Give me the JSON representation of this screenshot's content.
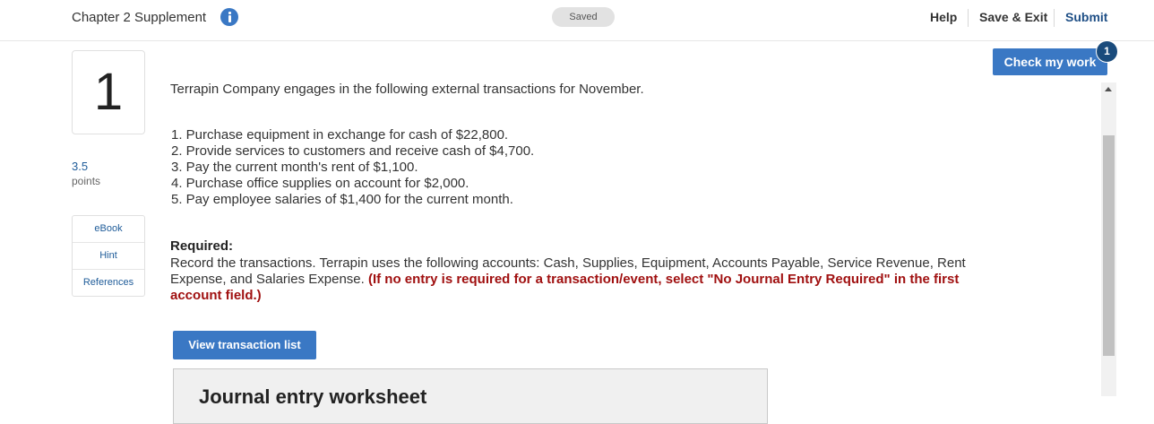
{
  "header": {
    "title": "Chapter 2 Supplement",
    "status": "Saved",
    "help": "Help",
    "save_exit": "Save & Exit",
    "submit": "Submit"
  },
  "question": {
    "number": "1",
    "points_value": "3.5",
    "points_label": "points"
  },
  "side_links": [
    "eBook",
    "Hint",
    "References"
  ],
  "check_work": {
    "label": "Check my work",
    "badge": "1"
  },
  "content": {
    "intro": "Terrapin Company engages in the following external transactions for November.",
    "transactions": [
      "1. Purchase equipment in exchange for cash of $22,800.",
      "2. Provide services to customers and receive cash of $4,700.",
      "3. Pay the current month's rent of $1,100.",
      "4. Purchase office supplies on account for $2,000.",
      "5. Pay employee salaries of $1,400 for the current month."
    ],
    "required_heading": "Required:",
    "required_text": "Record the transactions. Terrapin uses the following accounts: Cash, Supplies, Equipment, Accounts Payable, Service Revenue, Rent Expense, and Salaries Expense.",
    "required_note": "(If no entry is required for a transaction/event, select \"No Journal Entry Required\" in the first account field.)",
    "view_button": "View transaction list",
    "worksheet_title": "Journal entry worksheet"
  },
  "colors": {
    "accent": "#3a78c4",
    "badge": "#1a4b7c",
    "note": "#a01010",
    "link": "#1f5c99"
  },
  "icons": [
    "info-icon",
    "scroll-up-arrow-icon"
  ]
}
